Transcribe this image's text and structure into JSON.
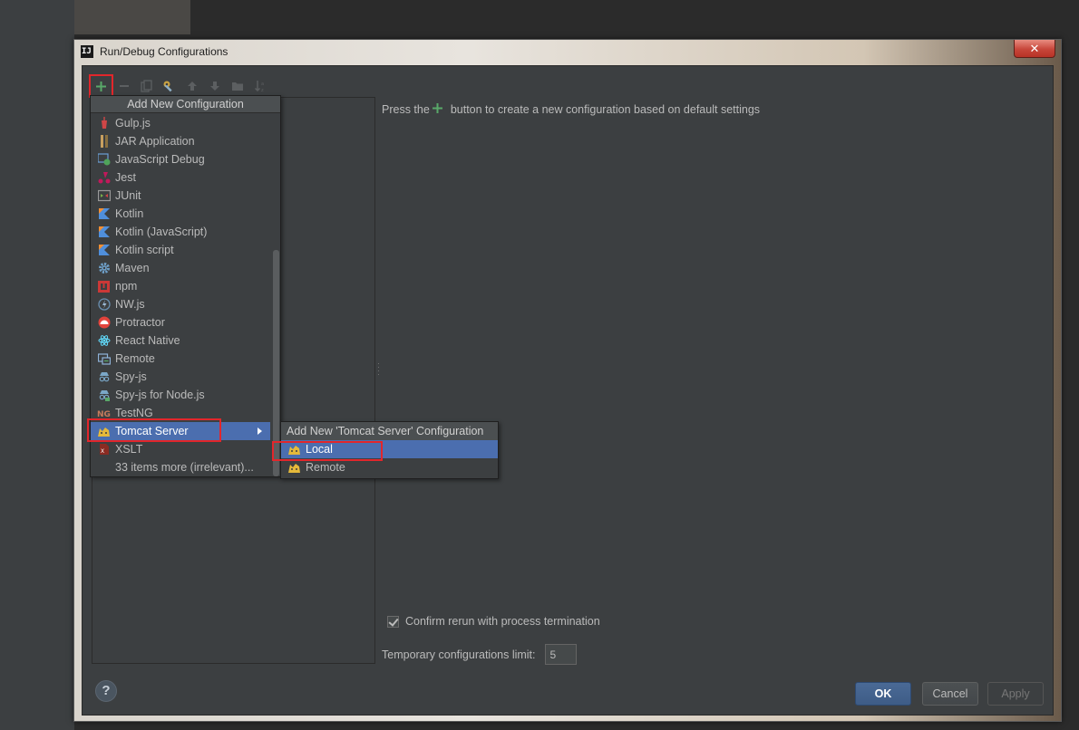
{
  "window": {
    "title": "Run/Debug Configurations",
    "app_icon_text": "IJ",
    "close_label": "✕"
  },
  "toolbar": {
    "add": "add-icon",
    "remove": "remove-icon",
    "copy": "copy-icon",
    "edit_defaults": "wrench-icon",
    "move_up": "arrow-up-icon",
    "move_down": "arrow-down-icon",
    "folder": "folder-icon",
    "sort": "sort-icon"
  },
  "hint": {
    "before": "Press the",
    "after": "button to create a new configuration based on default settings"
  },
  "menu": {
    "header": "Add New Configuration",
    "items": [
      {
        "label": "Gulp.js",
        "icon": "gulp-icon",
        "color": "#cf4647"
      },
      {
        "label": "JAR Application",
        "icon": "jar-icon",
        "color": "#c8a060"
      },
      {
        "label": "JavaScript Debug",
        "icon": "js-debug-icon",
        "color": "#6a9fd4"
      },
      {
        "label": "Jest",
        "icon": "jest-icon",
        "color": "#c2185b"
      },
      {
        "label": "JUnit",
        "icon": "junit-icon",
        "color": "#7cae4a"
      },
      {
        "label": "Kotlin",
        "icon": "kotlin-icon",
        "color": "#4f8fdc"
      },
      {
        "label": "Kotlin (JavaScript)",
        "icon": "kotlin-js-icon",
        "color": "#4f8fdc"
      },
      {
        "label": "Kotlin script",
        "icon": "kotlin-script-icon",
        "color": "#4f8fdc"
      },
      {
        "label": "Maven",
        "icon": "maven-gear-icon",
        "color": "#6e9fc8"
      },
      {
        "label": "npm",
        "icon": "npm-icon",
        "color": "#cb3837"
      },
      {
        "label": "NW.js",
        "icon": "nwjs-icon",
        "color": "#6a8fb0"
      },
      {
        "label": "Protractor",
        "icon": "protractor-icon",
        "color": "#e2433b"
      },
      {
        "label": "React Native",
        "icon": "react-icon",
        "color": "#61dafb"
      },
      {
        "label": "Remote",
        "icon": "remote-icon",
        "color": "#8fb3d9"
      },
      {
        "label": "Spy-js",
        "icon": "spyjs-icon",
        "color": "#7aa7c7"
      },
      {
        "label": "Spy-js for Node.js",
        "icon": "spyjs-node-icon",
        "color": "#7aa7c7"
      },
      {
        "label": "TestNG",
        "icon": "testng-icon",
        "color": "#c67b5c"
      },
      {
        "label": "Tomcat Server",
        "icon": "tomcat-icon",
        "color": "#e5b93a"
      },
      {
        "label": "XSLT",
        "icon": "xslt-icon",
        "color": "#c0392b"
      }
    ],
    "more": "33 items more (irrelevant)..."
  },
  "submenu": {
    "header": "Add New 'Tomcat Server' Configuration",
    "items": [
      {
        "label": "Local",
        "icon": "tomcat-local-icon"
      },
      {
        "label": "Remote",
        "icon": "tomcat-remote-icon"
      }
    ]
  },
  "options": {
    "confirm_rerun": "Confirm rerun with process termination",
    "confirm_checked": true,
    "temp_limit_label": "Temporary configurations limit:",
    "temp_limit_value": "5"
  },
  "buttons": {
    "ok": "OK",
    "cancel": "Cancel",
    "apply": "Apply",
    "help": "?"
  },
  "colors": {
    "accent": "#4b6eaf",
    "highlight_box": "#e2262b",
    "add_green": "#59a869"
  }
}
